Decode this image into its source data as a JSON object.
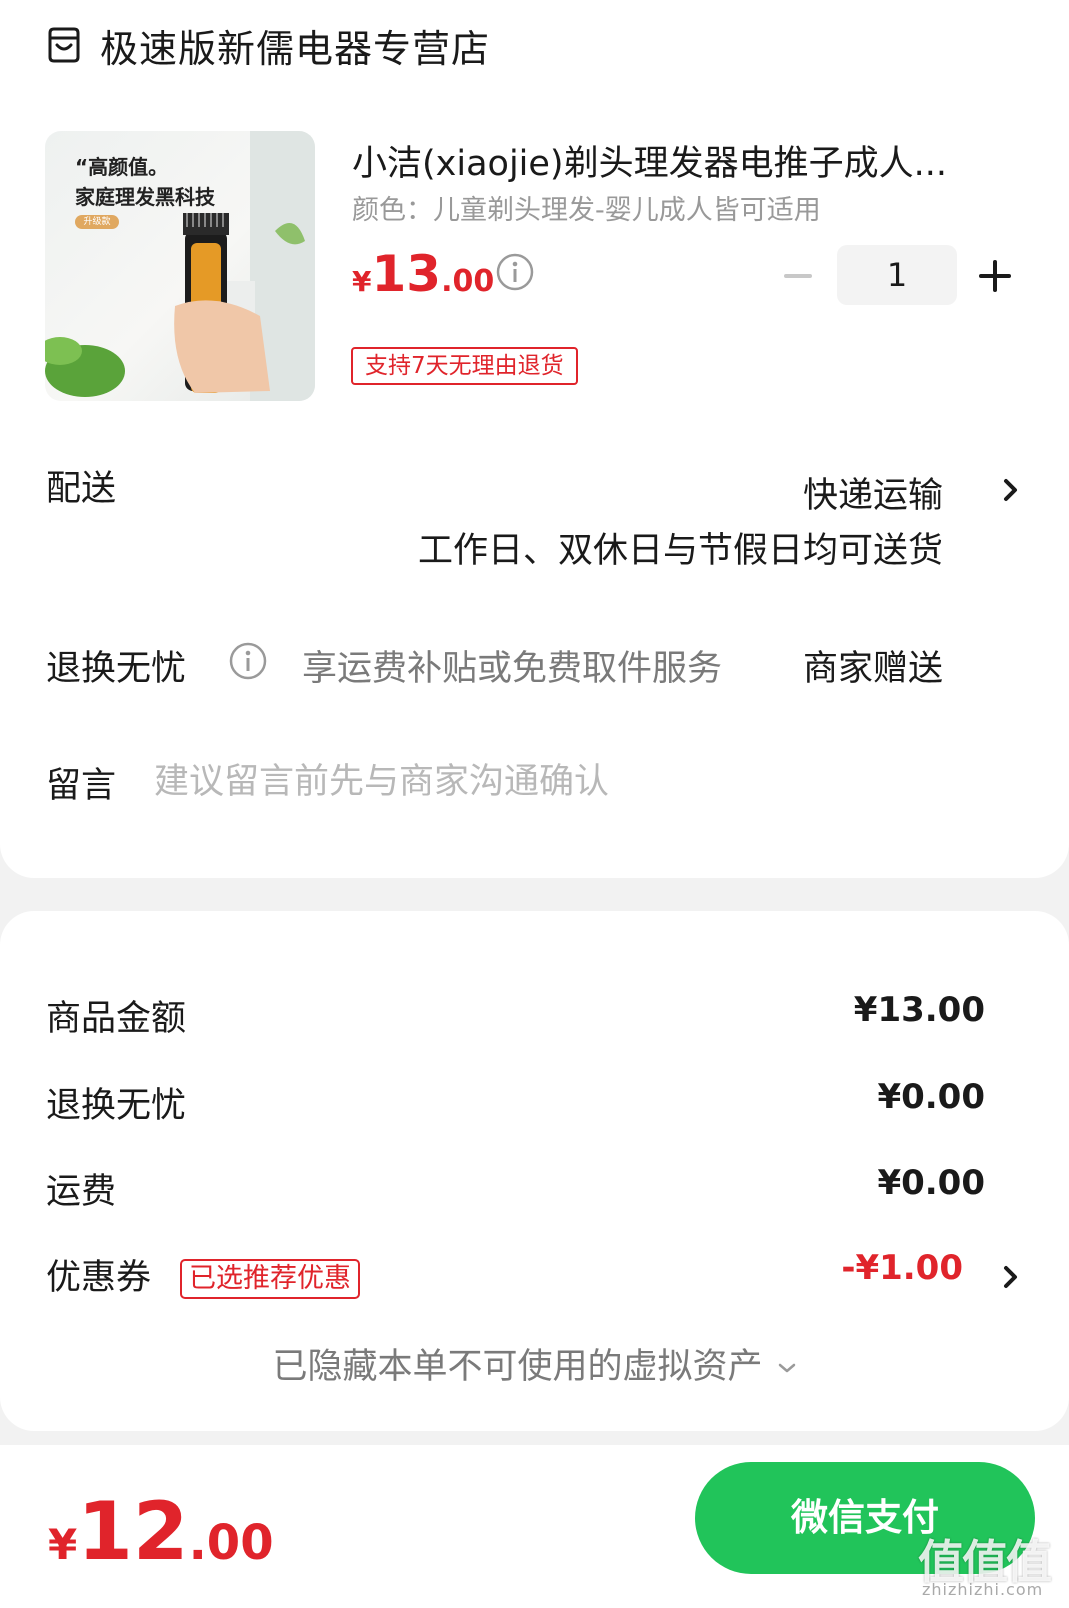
{
  "store": {
    "name": "极速版新儒电器专营店",
    "icon": "store-icon"
  },
  "product": {
    "image_text_line1": "“高颜值。",
    "image_text_line2": "家庭理发黑科技",
    "image_tag": "升级款",
    "title": "小洁(xiaojie)剃头理发器电推子成人...",
    "spec": "颜色：儿童剃头理发-婴儿成人皆可适用",
    "price_symbol": "¥",
    "price_int": "13",
    "price_dec": ".00",
    "quantity": "1",
    "return_tag": "支持7天无理由退货"
  },
  "delivery": {
    "label": "配送",
    "method": "快递运输",
    "desc": "工作日、双休日与节假日均可送货"
  },
  "return_service": {
    "label": "退换无忧",
    "desc": "享运费补贴或免费取件服务",
    "gift": "商家赠送"
  },
  "message": {
    "label": "留言",
    "placeholder": "建议留言前先与商家沟通确认"
  },
  "summary": {
    "goods_label": "商品金额",
    "goods_value": "¥13.00",
    "return_label": "退换无忧",
    "return_value": "¥0.00",
    "shipping_label": "运费",
    "shipping_value": "¥0.00",
    "coupon_label": "优惠券",
    "coupon_tag": "已选推荐优惠",
    "coupon_value": "-¥1.00",
    "hidden_assets": "已隐藏本单不可使用的虚拟资产"
  },
  "footer": {
    "total_symbol": "¥",
    "total_int": "12",
    "total_dec": ".00",
    "pay_label": "微信支付",
    "watermark": "值值值",
    "watermark_url": "zhizhizhi.com"
  },
  "colors": {
    "accent_red": "#e0242b",
    "pay_green": "#21c45a",
    "background": "#f2f2f2"
  }
}
